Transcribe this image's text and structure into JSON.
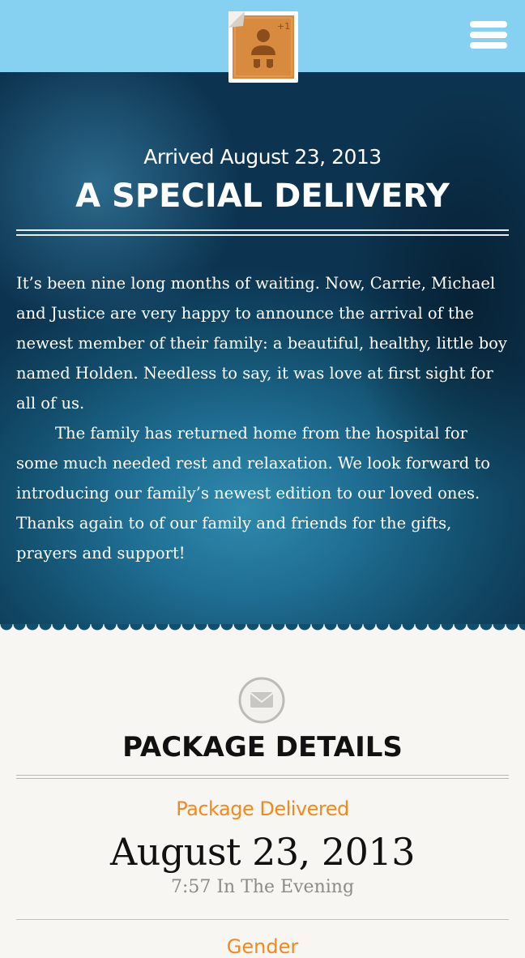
{
  "header": {
    "stamp_badge": "+1",
    "stamp_icon": "baby-stamp-icon",
    "menu_icon": "hamburger-menu-icon",
    "colors": {
      "bar": "#86d0f2",
      "stamp": "#d88a3e"
    }
  },
  "hero": {
    "arrived": "Arrived August 23, 2013",
    "title": "A SPECIAL DELIVERY",
    "paragraphs": [
      "It’s been nine long months of waiting. Now, Carrie, Michael and Justice are very happy to announce the arrival of the newest member of their family: a beautiful, healthy, little boy named Holden. Needless to say, it was love at first sight for all of us.",
      "The family has returned home from the hospital for some much needed rest and relaxation. We look forward to introducing our family’s newest edition to our loved ones. Thanks again to of our family and friends for the gifts, prayers and support!"
    ]
  },
  "details": {
    "icon": "envelope-icon",
    "title": "PACKAGE DETAILS",
    "delivered_label": "Package Delivered",
    "delivered_date": "August 23, 2013",
    "delivered_time": "7:57 In The Evening",
    "next_label": "Gender",
    "accent_color": "#f08a1d"
  }
}
